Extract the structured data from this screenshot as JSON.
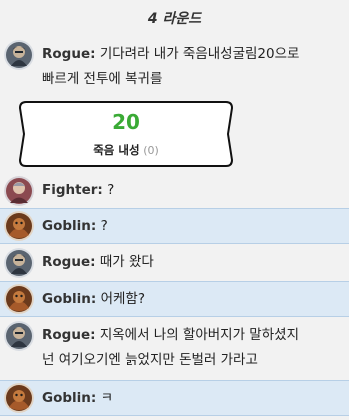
{
  "round_header": "4 라운드",
  "messages": [
    {
      "speaker": "Rogue",
      "avatar": "rogue-portrait-icon",
      "line1": "기다려라 내가 죽음내성굴림20으로",
      "line2": "빠르게 전투에 복귀를"
    },
    {
      "speaker": "Fighter",
      "avatar": "fighter-portrait-icon",
      "line1": "?"
    },
    {
      "speaker": "Goblin",
      "avatar": "goblin-portrait-icon",
      "line1": "?"
    },
    {
      "speaker": "Rogue",
      "avatar": "rogue-portrait-icon",
      "line1": "때가 왔다"
    },
    {
      "speaker": "Goblin",
      "avatar": "goblin-portrait-icon",
      "line1": "어케함?"
    },
    {
      "speaker": "Rogue",
      "avatar": "rogue-portrait-icon",
      "line1": "지옥에서 나의 할아버지가 말하셨지",
      "line2": "넌 여기오기엔 늙었지만 돈벌러 가라고"
    },
    {
      "speaker": "Goblin",
      "avatar": "goblin-portrait-icon",
      "line1": "ㅋ"
    }
  ],
  "roll_card": {
    "result": "20",
    "name": "죽음 내성",
    "base": "(0)"
  },
  "colors": {
    "highlight_bg": "#dce9f5",
    "result_green": "#3aaa35"
  }
}
